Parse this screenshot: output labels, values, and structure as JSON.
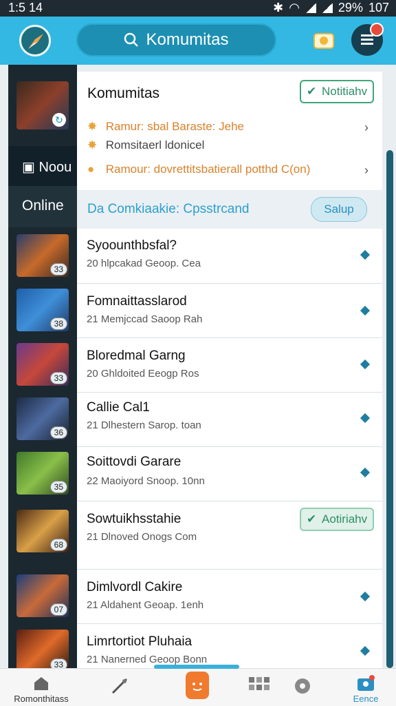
{
  "status_bar": {
    "time": "1:5 14",
    "battery": "29%",
    "extra": "107"
  },
  "header": {
    "search_label": "Komumitas"
  },
  "rail": {
    "nav_label": "Noou",
    "online_label": "Online"
  },
  "community": {
    "title": "Komumitas",
    "follow_label": "Notitiahv",
    "info": [
      {
        "icon": "star-icon",
        "text": "Ramur: sbal Baraste: Jehe",
        "color": "#d9822b"
      },
      {
        "icon": "star-icon",
        "text": "Romsitaerl ldonicel",
        "color": "#444444"
      },
      {
        "icon": "coin-icon",
        "text": "Ramour: dovrettitsbatierall potthd C(on)",
        "color": "#d9822b"
      }
    ],
    "band": {
      "label": "Da Comkiaakie:",
      "link": "Cpsstrcand",
      "button": "Salup"
    }
  },
  "groups": [
    {
      "name": "Syoounthbsfal?",
      "meta": "20 hlpcakad Geoop. Cea",
      "badge": "33"
    },
    {
      "name": "Fomnaittasslarod",
      "meta": "21 Memjccad Saoop Rah",
      "badge": "38"
    },
    {
      "name": "Bloredmal Garng",
      "meta": "20 Ghldoited Eeogp Ros",
      "badge": "33"
    },
    {
      "name": "Callie Cal1",
      "meta": "21 Dlhestern Sarop. toan",
      "badge": "36"
    },
    {
      "name": "Soittovdi Garare",
      "meta": "22 Maoiyord Snoop. 10nn",
      "badge": "35"
    },
    {
      "name": "Sowtuikhsstahie",
      "meta": "21 Dlnoved Onogs Com",
      "badge": "68",
      "follow": "Aotiriahv"
    },
    {
      "name": "Dimlvordl Cakire",
      "meta": "21 Aldahent Geoap. 1enh",
      "badge": "07"
    },
    {
      "name": "Limrtortiot Pluhaia",
      "meta": "21 Nanerned Geoop Bonn",
      "badge": "33"
    }
  ],
  "bottom_nav": [
    {
      "icon": "home-icon",
      "label": "Romonthitass"
    },
    {
      "icon": "wand-icon",
      "label": ""
    },
    {
      "icon": "chat-icon",
      "label": ""
    },
    {
      "icon": "grid-icon",
      "label": ""
    },
    {
      "icon": "settings-icon",
      "label": ""
    },
    {
      "icon": "profile-icon",
      "label": "Eence"
    }
  ],
  "colors": {
    "header": "#33b8e3",
    "rail": "#1b2830",
    "accent": "#2e9fd0",
    "follow": "#3fa57b",
    "orange": "#f07a2d"
  }
}
